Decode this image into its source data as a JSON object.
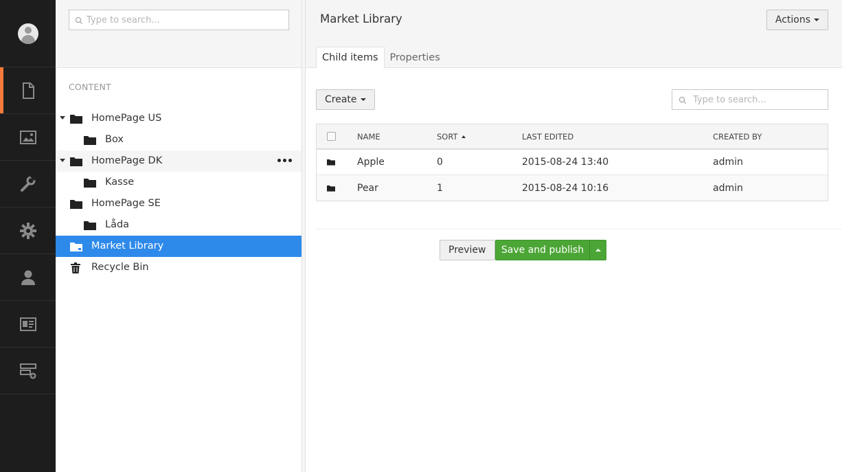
{
  "rail": {
    "items": [
      {
        "name": "content",
        "icon": "document-icon",
        "active": true
      },
      {
        "name": "media",
        "icon": "image-icon"
      },
      {
        "name": "settings-tools",
        "icon": "wrench-icon"
      },
      {
        "name": "developer",
        "icon": "gear-icon"
      },
      {
        "name": "users",
        "icon": "user-icon"
      },
      {
        "name": "members",
        "icon": "id-card-icon"
      },
      {
        "name": "forms",
        "icon": "layout-add-icon"
      }
    ]
  },
  "tree": {
    "search_placeholder": "Type to search...",
    "section_label": "CONTENT",
    "nodes": [
      {
        "label": "HomePage US",
        "depth": 0,
        "expanded": true,
        "icon": "folder-icon"
      },
      {
        "label": "Box",
        "depth": 1,
        "icon": "folder-icon"
      },
      {
        "label": "HomePage DK",
        "depth": 0,
        "expanded": true,
        "icon": "folder-icon",
        "hover": true
      },
      {
        "label": "Kasse",
        "depth": 1,
        "icon": "folder-icon"
      },
      {
        "label": "HomePage SE",
        "depth": 0,
        "icon": "folder-icon"
      },
      {
        "label": "Låda",
        "depth": 1,
        "icon": "folder-icon"
      },
      {
        "label": "Market Library",
        "depth": 0,
        "icon": "folder-icon",
        "selected": true
      },
      {
        "label": "Recycle Bin",
        "depth": 0,
        "icon": "trash-icon"
      }
    ]
  },
  "main": {
    "title": "Market Library",
    "actions_label": "Actions",
    "tabs": [
      {
        "label": "Child items",
        "active": true
      },
      {
        "label": "Properties"
      }
    ],
    "create_label": "Create",
    "search_placeholder": "Type to search...",
    "columns": {
      "name": "NAME",
      "sort": "SORT",
      "last_edited": "LAST EDITED",
      "created_by": "CREATED BY"
    },
    "rows": [
      {
        "name": "Apple",
        "sort": "0",
        "last_edited": "2015-08-24 13:40",
        "created_by": "admin"
      },
      {
        "name": "Pear",
        "sort": "1",
        "last_edited": "2015-08-24 10:16",
        "created_by": "admin"
      }
    ],
    "preview_label": "Preview",
    "publish_label": "Save and publish"
  },
  "colors": {
    "rail_bg": "#1d1d1d",
    "rail_active": "#f5793a",
    "selected_node": "#2e8aea",
    "publish_green": "#4ca636"
  }
}
